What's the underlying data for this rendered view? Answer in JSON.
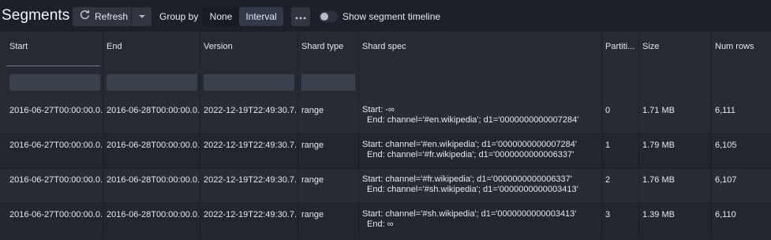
{
  "header": {
    "title": "Segments",
    "refresh_label": "Refresh",
    "group_by_label": "Group by",
    "group_options": [
      "None",
      "Interval"
    ],
    "group_selected": "Interval",
    "more_label": "•••",
    "timeline_label": "Show segment timeline",
    "timeline_enabled": false
  },
  "table": {
    "columns": [
      "Start",
      "End",
      "Version",
      "Shard type",
      "Shard spec",
      "Partiti...",
      "Size",
      "Num rows"
    ],
    "rows": [
      {
        "start": "2016-06-27T00:00:00.0...",
        "end": "2016-06-28T00:00:00.0...",
        "version": "2022-12-19T22:49:30.7...",
        "shard_type": "range",
        "spec_start": "Start: -∞",
        "spec_end": "End: channel='#en.wikipedia'; d1='0000000000007284'",
        "partition": "0",
        "size": "1.71 MB",
        "num_rows": "6,111"
      },
      {
        "start": "2016-06-27T00:00:00.0...",
        "end": "2016-06-28T00:00:00.0...",
        "version": "2022-12-19T22:49:30.7...",
        "shard_type": "range",
        "spec_start": "Start: channel='#en.wikipedia'; d1='0000000000007284'",
        "spec_end": "End: channel='#fr.wikipedia'; d1='0000000000006337'",
        "partition": "1",
        "size": "1.79 MB",
        "num_rows": "6,105"
      },
      {
        "start": "2016-06-27T00:00:00.0...",
        "end": "2016-06-28T00:00:00.0...",
        "version": "2022-12-19T22:49:30.7...",
        "shard_type": "range",
        "spec_start": "Start: channel='#fr.wikipedia'; d1='0000000000006337'",
        "spec_end": "End: channel='#sh.wikipedia'; d1='0000000000003413'",
        "partition": "2",
        "size": "1.76 MB",
        "num_rows": "6,107"
      },
      {
        "start": "2016-06-27T00:00:00.0...",
        "end": "2016-06-28T00:00:00.0...",
        "version": "2022-12-19T22:49:30.7...",
        "shard_type": "range",
        "spec_start": "Start: channel='#sh.wikipedia'; d1='0000000000003413'",
        "spec_end": "End: ∞",
        "partition": "3",
        "size": "1.39 MB",
        "num_rows": "6,110"
      }
    ]
  }
}
